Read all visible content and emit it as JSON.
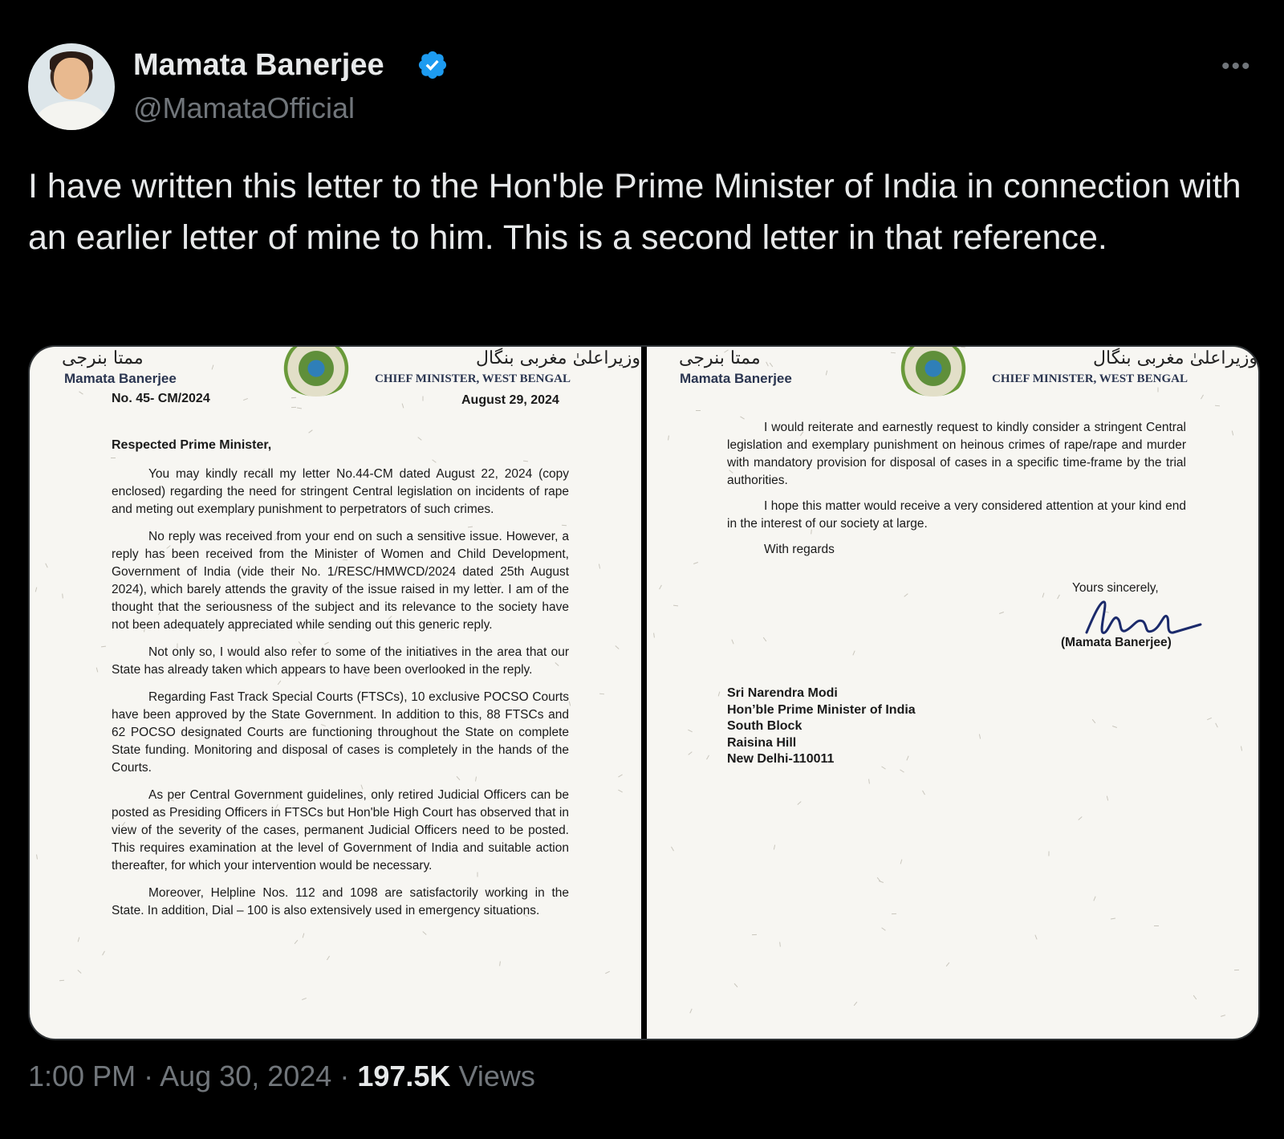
{
  "author": {
    "name": "Mamata Banerjee",
    "handle": "@MamataOfficial",
    "verified": true,
    "avatar_icon": "profile-photo"
  },
  "more_label": "•••",
  "tweet": {
    "text": "I have written this letter to the Hon'ble Prime Minister of India in connection with an earlier letter of mine to him. This is a second letter in that reference.",
    "time": "1:00 PM",
    "date": "Aug 30, 2024",
    "separator": "·",
    "views_count": "197.5K",
    "views_label": "Views"
  },
  "letterhead": {
    "urdu_name": "ممتا بنرجی",
    "urdu_title": "وزیراعلیٰ مغربی بنگال",
    "name": "Mamata Banerjee",
    "title": "CHIEF MINISTER, WEST BENGAL"
  },
  "letter_page1": {
    "number": "No. 45- CM/2024",
    "date": "August 29, 2024",
    "salutation": "Respected Prime Minister,",
    "paragraphs": [
      "You may kindly recall my letter No.44-CM dated August 22, 2024 (copy enclosed) regarding the need for stringent Central legislation on incidents of rape and meting out exemplary punishment to perpetrators of such crimes.",
      "No reply was received from your end on such a sensitive issue. However, a reply has been received from the Minister of Women and Child Development, Government of India (vide their No. 1/RESC/HMWCD/2024 dated 25th August 2024), which barely attends the gravity of the issue raised in my letter. I am of the thought that the seriousness of the subject and its relevance to the society have not been adequately appreciated while sending out this generic reply.",
      "Not only so, I would also refer to some of the initiatives in the area that our State has already taken which appears to have been overlooked in the reply.",
      "Regarding Fast Track Special Courts (FTSCs), 10 exclusive POCSO Courts have been approved by the State Government. In addition to this, 88 FTSCs and 62 POCSO designated Courts are functioning throughout the State on complete State funding. Monitoring and disposal of cases is completely in the hands of the Courts.",
      "As per Central Government guidelines, only retired Judicial Officers can be posted as Presiding Officers in FTSCs but Hon'ble High Court has observed that in view of the severity of the cases, permanent Judicial Officers need to be posted. This requires examination at the level of Government of India and suitable action thereafter, for which your intervention would be necessary.",
      "Moreover, Helpline Nos. 112 and 1098 are satisfactorily working in the State. In addition, Dial – 100 is also extensively used in emergency situations."
    ]
  },
  "letter_page2": {
    "paragraphs": [
      "I would reiterate and earnestly request to kindly consider a stringent Central legislation and exemplary punishment on heinous crimes of rape/rape and murder with mandatory provision for disposal of cases in a specific time-frame by the trial authorities.",
      "I hope this matter would receive a very considered attention at your kind end in the interest of our society at large."
    ],
    "regards": "With regards",
    "closing": "Yours sincerely,",
    "signatory": "(Mamata Banerjee)",
    "address": [
      "Sri Narendra Modi",
      "Hon’ble Prime Minister of India",
      "South Block",
      "Raisina Hill",
      "New Delhi-110011"
    ]
  },
  "colors": {
    "background": "#000000",
    "primary_text": "#e7e9ea",
    "secondary_text": "#71767b",
    "verified_blue": "#1d9bf0",
    "paper": "#f7f6f2"
  }
}
